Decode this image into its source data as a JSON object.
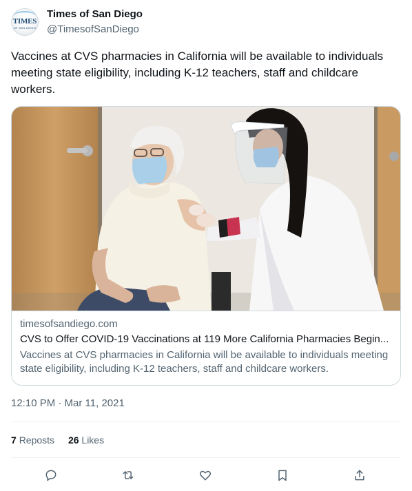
{
  "author": {
    "name": "Times of San Diego",
    "handle": "@TimesofSanDiego",
    "avatar_text": "TIMES",
    "avatar_subtext": "OF SAN DIEGO"
  },
  "tweet": {
    "text": "Vaccines at CVS pharmacies in California will be available to individuals meeting state eligibility, including K-12 teachers, staff and childcare workers."
  },
  "card": {
    "domain": "timesofsandiego.com",
    "title": "CVS to Offer COVID-19 Vaccinations at 119 More California Pharmacies Begin...",
    "description": "Vaccines at CVS pharmacies in California will be available to individuals meeting state eligibility, including K-12 teachers, staff and childcare workers.",
    "image_alt": "Elderly woman receiving a vaccine from a healthcare worker in a face shield"
  },
  "timestamp": "12:10 PM · Mar 11, 2021",
  "stats": {
    "reposts_count": "7",
    "reposts_label": "Reposts",
    "likes_count": "26",
    "likes_label": "Likes"
  },
  "actions": [
    "reply-icon",
    "repost-icon",
    "like-icon",
    "bookmark-icon",
    "share-icon"
  ],
  "colors": {
    "text": "#0f1419",
    "secondary": "#536471",
    "border": "#cfd9de"
  }
}
